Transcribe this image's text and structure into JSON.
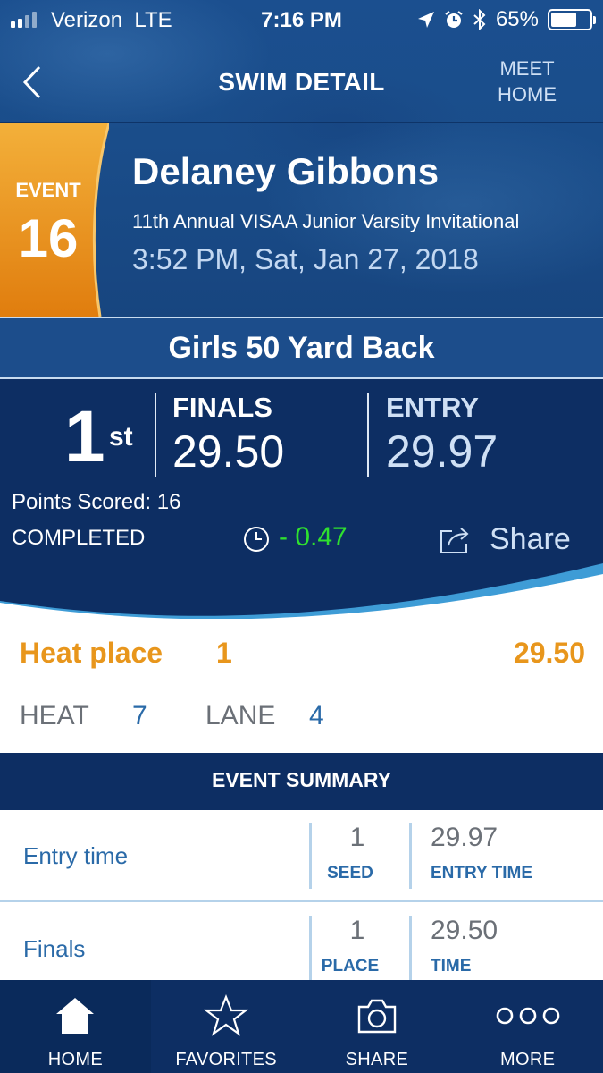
{
  "status_bar": {
    "carrier": "Verizon",
    "network": "LTE",
    "time": "7:16 PM",
    "battery": "65%"
  },
  "nav": {
    "title": "SWIM DETAIL",
    "meet_home_line1": "MEET",
    "meet_home_line2": "HOME"
  },
  "event": {
    "label": "EVENT",
    "number": "16",
    "swimmer": "Delaney Gibbons",
    "meet": "11th Annual VISAA Junior Varsity Invitational",
    "datetime": "3:52 PM, Sat, Jan 27, 2018",
    "name": "Girls 50 Yard Back"
  },
  "result": {
    "place": "1",
    "place_suffix": "st",
    "finals_label": "FINALS",
    "finals_time": "29.50",
    "entry_label": "ENTRY",
    "entry_time": "29.97",
    "points": "Points Scored: 16",
    "status": "COMPLETED",
    "time_diff": "- 0.47",
    "share_label": "Share"
  },
  "heat": {
    "place_label": "Heat place",
    "place": "1",
    "time": "29.50",
    "heat_label": "HEAT",
    "heat": "7",
    "lane_label": "LANE",
    "lane": "4"
  },
  "summary": {
    "title": "EVENT SUMMARY",
    "rows": [
      {
        "name": "Entry time",
        "value1": "1",
        "label1": "SEED",
        "value2": "29.97",
        "label2": "ENTRY TIME"
      },
      {
        "name": "Finals",
        "value1": "1",
        "label1": "PLACE",
        "value2": "29.50",
        "label2": "TIME"
      }
    ]
  },
  "tabs": [
    {
      "label": "HOME",
      "icon": "home-icon",
      "active": true
    },
    {
      "label": "FAVORITES",
      "icon": "star-icon",
      "active": false
    },
    {
      "label": "SHARE",
      "icon": "camera-icon",
      "active": false
    },
    {
      "label": "MORE",
      "icon": "more-icon",
      "active": false
    }
  ],
  "colors": {
    "navy": "#0d2e63",
    "blue": "#1b4f8f",
    "orange": "#e8961c",
    "green": "#2fe02f",
    "link": "#2a6aa8"
  }
}
